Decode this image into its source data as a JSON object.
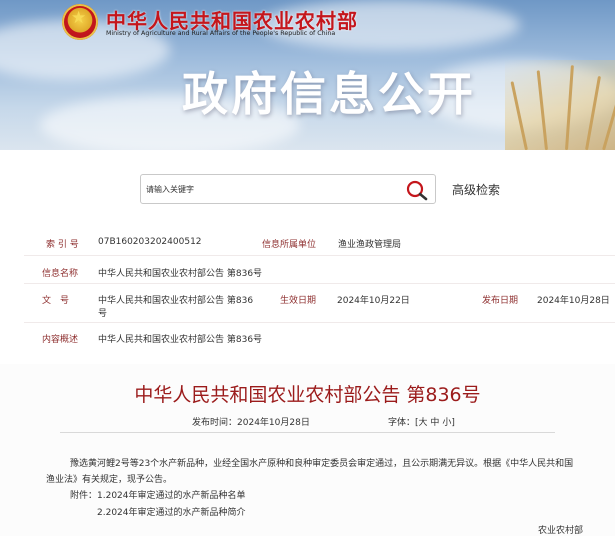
{
  "header": {
    "ministry_cn": "中华人民共和国农业农村部",
    "ministry_en": "Ministry of Agriculture and Rural Affairs of the People's Republic of China",
    "banner_title": "政府信息公开"
  },
  "search": {
    "placeholder": "请输入关键字",
    "advanced_label": "高级检索"
  },
  "meta": {
    "index_label": "索 引 号",
    "index_value": "07B160203202400512",
    "org_label": "信息所属单位",
    "org_value": "渔业渔政管理局",
    "name_label": "信息名称",
    "name_value": "中华人民共和国农业农村部公告 第836号",
    "doc_label": "文　号",
    "doc_value_line1": "中华人民共和国农业农村部公告 第836",
    "doc_value_line2": "号",
    "effective_label": "生效日期",
    "effective_value": "2024年10月22日",
    "publish_label": "发布日期",
    "publish_value": "2024年10月28日",
    "summary_label": "内容概述",
    "summary_value": "中华人民共和国农业农村部公告 第836号"
  },
  "article": {
    "title": "中华人民共和国农业农村部公告 第836号",
    "publish_time_label": "发布时间：",
    "publish_time_value": "2024年10月28日",
    "font_label": "字体：",
    "font_open": "[",
    "font_large": "大",
    "font_medium": "中",
    "font_small": "小",
    "font_close": "]",
    "para1_line1": "豫选黄河鲤2号等23个水产新品种，业经全国水产原种和良种审定委员会审定通过，且公示期满无异议。根据《中华人民共和国",
    "para1_line2": "渔业法》有关规定，现予公告。",
    "attachment_label": "附件：",
    "attachment_1": "1.2024年审定通过的水产新品种名单",
    "attachment_2": "2.2024年审定通过的水产新品种简介",
    "signature": "农业农村部"
  },
  "colors": {
    "label_red": "#8e2f2f",
    "title_red": "#9b1b1b",
    "brand_red": "#c4161c"
  },
  "icons": [
    "national-emblem-icon",
    "search-icon"
  ]
}
